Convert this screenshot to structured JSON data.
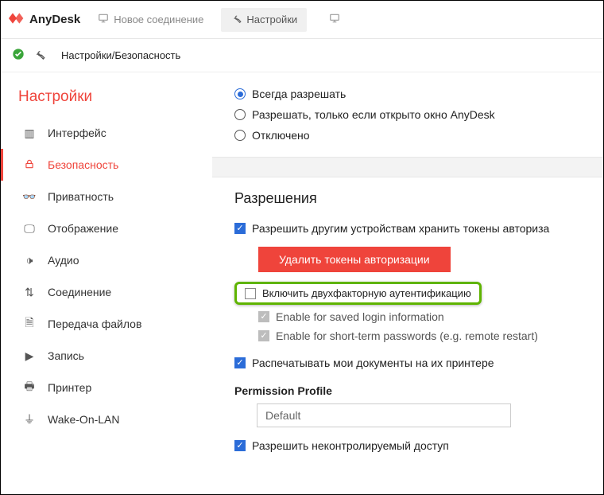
{
  "app": {
    "name": "AnyDesk",
    "new_connection": "Новое соединение",
    "tab_settings": "Настройки"
  },
  "breadcrumb": "Настройки/Безопасность",
  "sidebar": {
    "title": "Настройки",
    "items": [
      {
        "label": "Интерфейс"
      },
      {
        "label": "Безопасность"
      },
      {
        "label": "Приватность"
      },
      {
        "label": "Отображение"
      },
      {
        "label": "Аудио"
      },
      {
        "label": "Соединение"
      },
      {
        "label": "Передача файлов"
      },
      {
        "label": "Запись"
      },
      {
        "label": "Принтер"
      },
      {
        "label": "Wake-On-LAN"
      }
    ]
  },
  "radios": {
    "always": "Всегда разрешать",
    "only_window": "Разрешать, только если открыто окно AnyDesk",
    "disabled": "Отключено"
  },
  "permissions": {
    "title": "Разрешения",
    "store_tokens": "Разрешить другим устройствам хранить токены авториза",
    "delete_tokens_btn": "Удалить токены авторизации",
    "two_factor": "Включить двухфакторную аутентификацию",
    "enable_saved": "Enable for saved login information",
    "enable_short": "Enable for short-term passwords (e.g. remote restart)",
    "print_docs": "Распечатывать мои документы на их принтере",
    "profile_label": "Permission Profile",
    "profile_value": "Default",
    "allow_uncontrolled": "Разрешить неконтролируемый доступ"
  }
}
